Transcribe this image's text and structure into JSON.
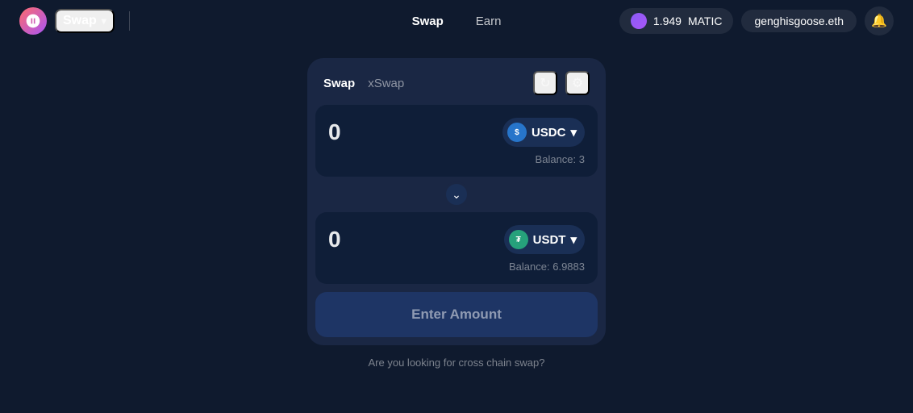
{
  "navbar": {
    "swap_dropdown_label": "Swap",
    "nav_links": [
      {
        "id": "swap",
        "label": "Swap",
        "active": true
      },
      {
        "id": "earn",
        "label": "Earn",
        "active": false
      }
    ],
    "matic_amount": "1.949",
    "matic_symbol": "MATIC",
    "wallet_address": "genghisgoose.eth"
  },
  "card": {
    "tabs": [
      {
        "id": "swap",
        "label": "Swap",
        "active": true
      },
      {
        "id": "xswap",
        "label": "xSwap",
        "active": false
      }
    ],
    "from_token": {
      "amount": "0",
      "symbol": "USDC",
      "balance_label": "Balance:",
      "balance_value": "3"
    },
    "to_token": {
      "amount": "0",
      "symbol": "USDT",
      "balance_label": "Balance:",
      "balance_value": "6.9883"
    },
    "enter_amount_label": "Enter Amount",
    "cross_chain_text": "Are you looking for cross chain swap?"
  },
  "icons": {
    "chevron_down": "⌄",
    "settings": "⚙",
    "refresh": "↻",
    "bell": "🔔",
    "swap_arrow": "⌄"
  }
}
